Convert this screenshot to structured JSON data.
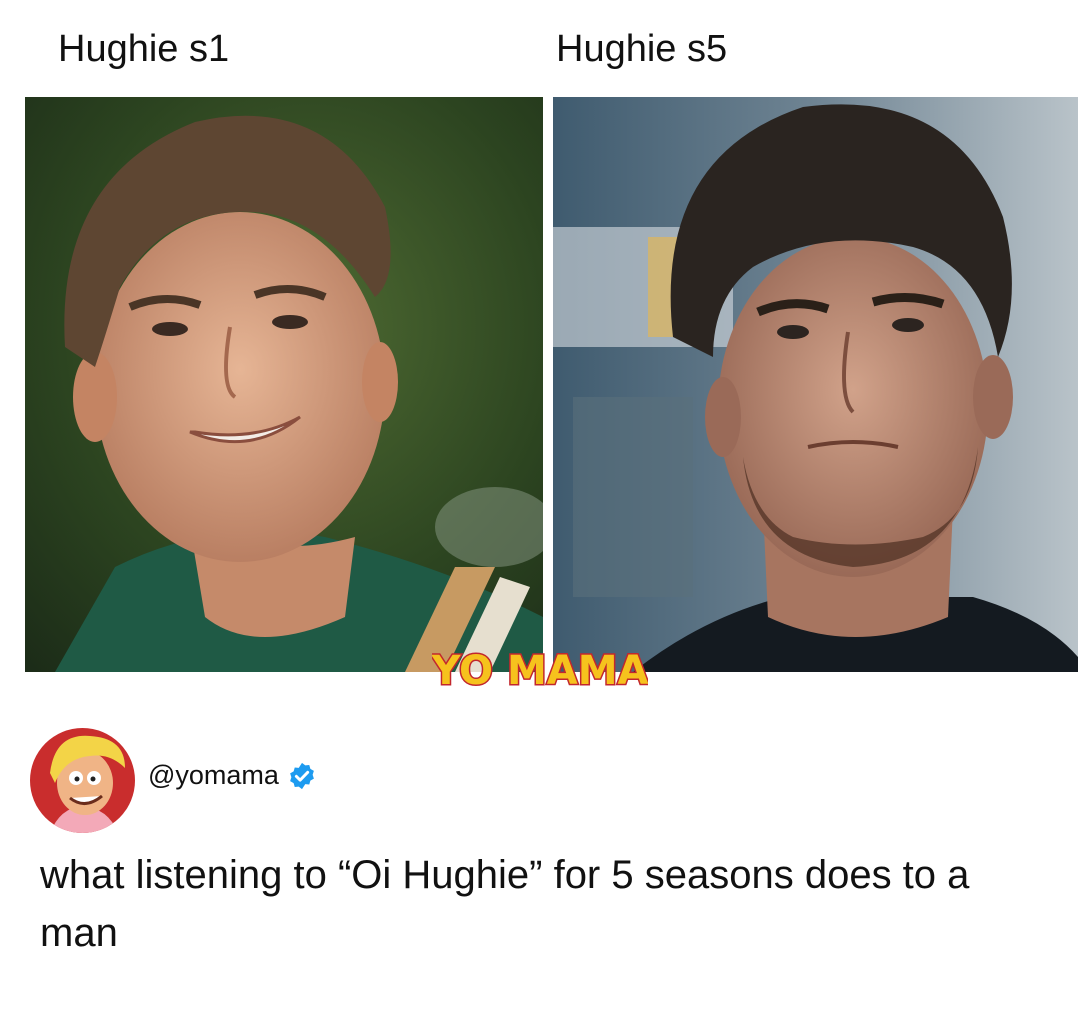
{
  "labels": {
    "left": "Hughie s1",
    "right": "Hughie s5"
  },
  "photos": {
    "left_icon": "portrait-photo-season1",
    "right_icon": "portrait-photo-season5"
  },
  "watermark": {
    "text": "YO MAMA",
    "color_fill": "#f6c21d",
    "color_outline": "#c2272d"
  },
  "post": {
    "avatar_icon": "cartoon-avatar-icon",
    "handle": "@yomama",
    "verified_icon": "verified-badge-icon",
    "verified_color": "#1d9bf0",
    "text": "what listening to “Oi Hughie” for 5 seasons does to a man"
  }
}
